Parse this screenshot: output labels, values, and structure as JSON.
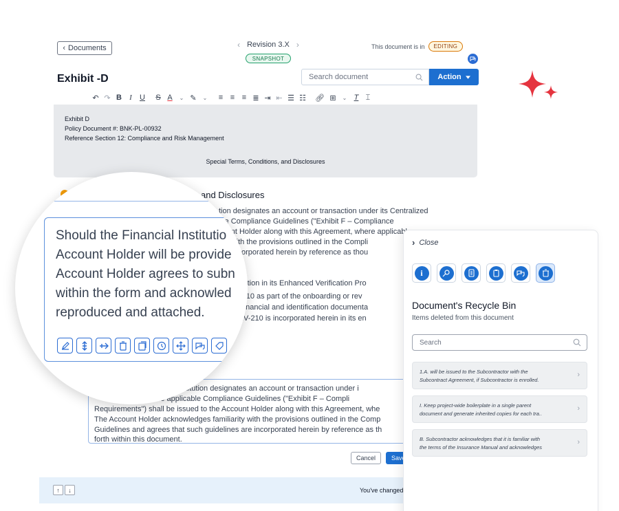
{
  "header": {
    "back_label": "Documents",
    "revision_label": "Revision 3.X",
    "snapshot_badge": "SNAPSHOT",
    "status_prefix": "This document is in",
    "status_badge": "EDITING",
    "doc_title": "Exhibit -D",
    "search_placeholder": "Search document",
    "action_label": "Action"
  },
  "editor": {
    "line1": "Exhibit D",
    "line2": "Policy Document #: BNK-PL-00932",
    "line3": "Reference Section 12: Compliance and Risk Management",
    "center_heading": "Special Terms, Conditions, and Disclosures"
  },
  "section": {
    "heading": "and Disclosures",
    "para1": [
      "tion designates an account or transaction under its Centralized",
      "ble Compliance Guidelines (\"Exhibit F – Compliance",
      "count Holder along with this Agreement, where applicable.",
      "rity with the provisions outlined in the Compli",
      "are incorporated herein by reference as thou"
    ],
    "para2": [
      "participation in its Enhanced Verification Pro",
      "rm EV-210 as part of the onboarding or rev",
      "quired financial and identification documenta",
      "Form EV-210 is incorporated herein in its en"
    ]
  },
  "bottom_editor": {
    "lines": [
      "ial Institution designates an account or transaction under i",
      "gram, the applicable Compliance Guidelines (\"Exhibit F – Compli",
      "Requirements\") shall be issued to the Account Holder along with this Agreement, whe",
      "The Account Holder acknowledges familiarity with the provisions outlined in the Comp",
      "Guidelines and agrees that such guidelines are incorporated herein by reference as th",
      "forth within this document."
    ],
    "cancel_label": "Cancel",
    "save_label": "Save"
  },
  "footer": {
    "changed_text": "You've changed"
  },
  "zoom": {
    "lines": [
      "Should the Financial Institutio",
      "Account Holder will be provide",
      "Account Holder agrees to subn",
      "within the form and acknowled",
      "reproduced and attached."
    ]
  },
  "panel": {
    "close_label": "Close",
    "title": "Document's Recycle Bin",
    "subtitle": "Items deleted from this document",
    "search_placeholder": "Search",
    "items": [
      {
        "line1": "1.A. will be issued to the Subcontractor with the",
        "line2": "Subcontract Agreement, if Subcontractor is enrolled."
      },
      {
        "line1": "I. Keep project-wide boilerplate in a single parent",
        "line2": "document and generate inherited copies for each tra.."
      },
      {
        "line1": "B. Subcontractor acknowledges that it is familiar with",
        "line2": "the terms of the Insurance Manual and acknowledges"
      }
    ]
  },
  "colors": {
    "accent": "#1d6fd0",
    "sparkle": "#e5343f",
    "editing": "#d97706",
    "snapshot": "#22a06b"
  }
}
